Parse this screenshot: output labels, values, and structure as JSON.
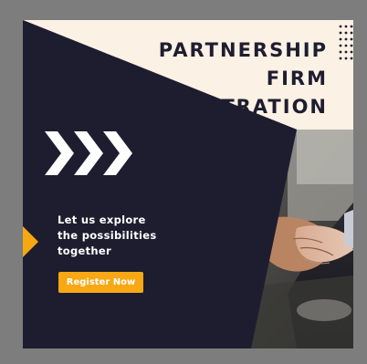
{
  "title": {
    "line1": "PARTNERSHIP",
    "line2": "FIRM",
    "line3": "REGISTRATION"
  },
  "tagline": {
    "line1": "Let us explore",
    "line2": "the possibilities",
    "line3": "together"
  },
  "cta": {
    "label": "Register Now"
  },
  "colors": {
    "background_cream": "#fbf1e4",
    "navy": "#1e1d30",
    "accent_orange": "#f6a711",
    "frame_gray": "#7d7d7d"
  },
  "icons": {
    "arrows": "triple-chevron-right",
    "dots": "dot-grid",
    "pointer": "orange-triangle"
  }
}
